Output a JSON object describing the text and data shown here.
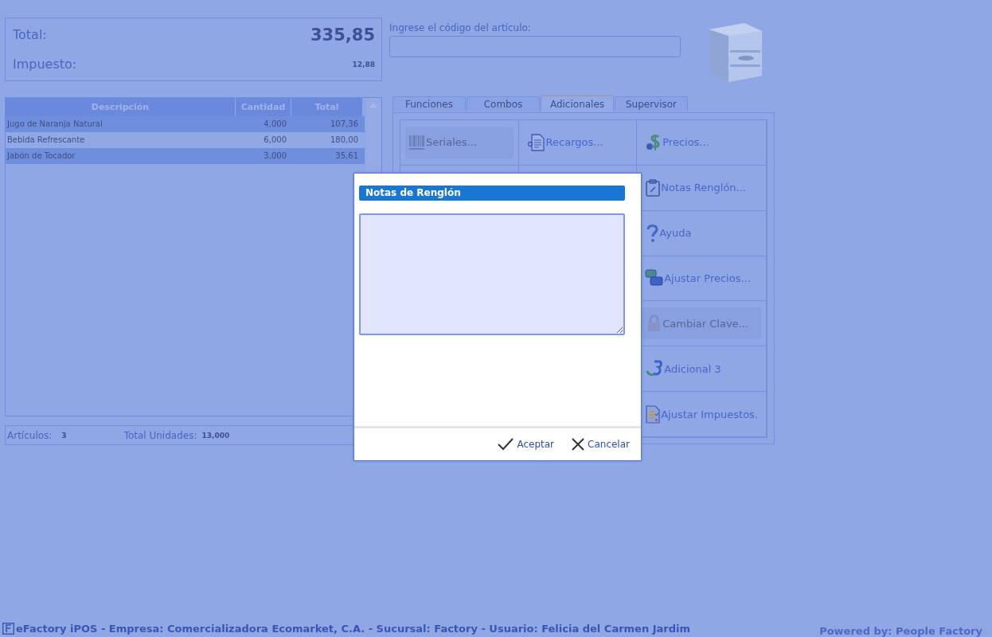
{
  "summary": {
    "total_label": "Total:",
    "total_value": "335,85",
    "tax_label": "Impuesto:",
    "tax_value": "12,88"
  },
  "item_code": {
    "label": "Ingrese el código del artículo:"
  },
  "table": {
    "columns": [
      "Descripción",
      "Cantidad",
      "Total"
    ],
    "rows": [
      {
        "cells": [
          "Jugo de Naranja Natural",
          "4,000",
          "107,36"
        ]
      },
      {
        "cells": [
          "Bebida Refrescante",
          "6,000",
          "180,00"
        ]
      },
      {
        "cells": [
          "Jabón de Tocador",
          "3,000",
          "35,61"
        ]
      }
    ]
  },
  "totals_bar": {
    "items_label": "Artículos:",
    "items_value": "3",
    "units_label": "Total Unidades:",
    "units_value": "13,000"
  },
  "tabs": [
    {
      "label": "Funciones",
      "selected": false
    },
    {
      "label": "Combos",
      "selected": false
    },
    {
      "label": "Adicionales",
      "selected": true
    },
    {
      "label": "Supervisor",
      "selected": false
    }
  ],
  "function_buttons": [
    {
      "label": "Seriales...",
      "disabled": true
    },
    {
      "label": "Recargos...",
      "disabled": false
    },
    {
      "label": "Precios...",
      "disabled": false
    },
    {
      "label": "Notas Renglón...",
      "disabled": false
    },
    {
      "label": "Ayuda",
      "disabled": false
    },
    {
      "label": "Ajustar Precios...",
      "disabled": false
    },
    {
      "label": "Cambiar Clave...",
      "disabled": true
    },
    {
      "label": "Adicional 3",
      "disabled": false
    },
    {
      "label": "Ajustar Impuestos.",
      "disabled": false
    }
  ],
  "dialog": {
    "title": "Notas de Renglón",
    "buttons": [
      {
        "label": "Aceptar",
        "kind": "accept"
      },
      {
        "label": "Cancelar",
        "kind": "cancel"
      }
    ]
  },
  "status_bar": {
    "text": "eFactory iPOS - Empresa: Comercializadora Ecomarket, C.A. - Sucursal: Factory - Usuario: Felicia del Carmen Jardim",
    "powered_by": "Powered by: People Factory"
  }
}
